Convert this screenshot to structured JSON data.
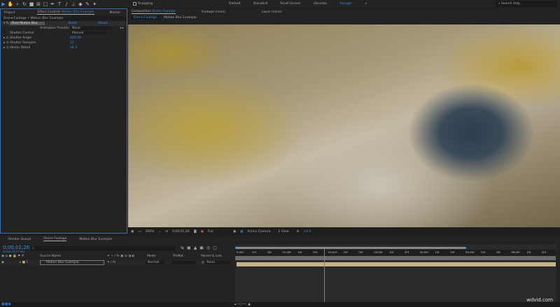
{
  "toolbar": {
    "snapping": "Snapping",
    "workspaces": [
      "Default",
      "Standard",
      "Small Screen",
      "Libraries",
      "Voyager"
    ],
    "search_placeholder": "Search Help"
  },
  "left": {
    "tabs": {
      "project": "Project",
      "effect_controls": "Effect Controls",
      "effect_layer": "Motion Blur Example",
      "marker": "Marker"
    },
    "breadcrumb": "Drone Footage • Motion Blur Example",
    "effect_name": "Pixel Motion Blur",
    "reset": "Reset",
    "about": "About...",
    "presets_label": "Animation Presets:",
    "presets_value": "None",
    "params": [
      {
        "name": "Shutter Control",
        "value": "Manual"
      },
      {
        "name": "Shutter Angle",
        "value": "600.00"
      },
      {
        "name": "Shutter Samples",
        "value": "12"
      },
      {
        "name": "Vector Detail",
        "value": "34.3"
      }
    ]
  },
  "viewer": {
    "tab_label": "Composition",
    "tab_comp": "Drone Footage",
    "footage": "Footage (none)",
    "layer": "Layer (none)",
    "crumbs": [
      "Drone Footage",
      "Motion Blur Example"
    ],
    "zoom": "200%",
    "timecode": "0;00;01;26",
    "resolution": "Full",
    "camera": "Active Camera",
    "views": "1 View",
    "exposure": "+0.0"
  },
  "timeline": {
    "tabs": [
      "Render Queue",
      "Drone Footage",
      "Motion Blur Example"
    ],
    "timecode": "0;00;01;26",
    "fps": "00056 (29.97 fps)",
    "columns": {
      "source": "Source Name",
      "mode": "Mode",
      "trkmat": "TrkMat",
      "parent": "Parent & Link"
    },
    "layer": {
      "index": "1",
      "name": "Motion Blur Example",
      "mode": "Normal",
      "parent": "None"
    },
    "ruler": [
      "0:00f",
      "10f",
      "20f",
      "01:00f",
      "10f",
      "20f",
      "02:00f",
      "10f",
      "20f",
      "03:00f",
      "10f",
      "20f",
      "04:00f",
      "10f",
      "20f",
      "05:00f",
      "10f",
      "20f",
      "06:00f",
      "10f",
      "20f"
    ],
    "playhead_fraction": 0.277
  },
  "watermark": "wdvid.com"
}
